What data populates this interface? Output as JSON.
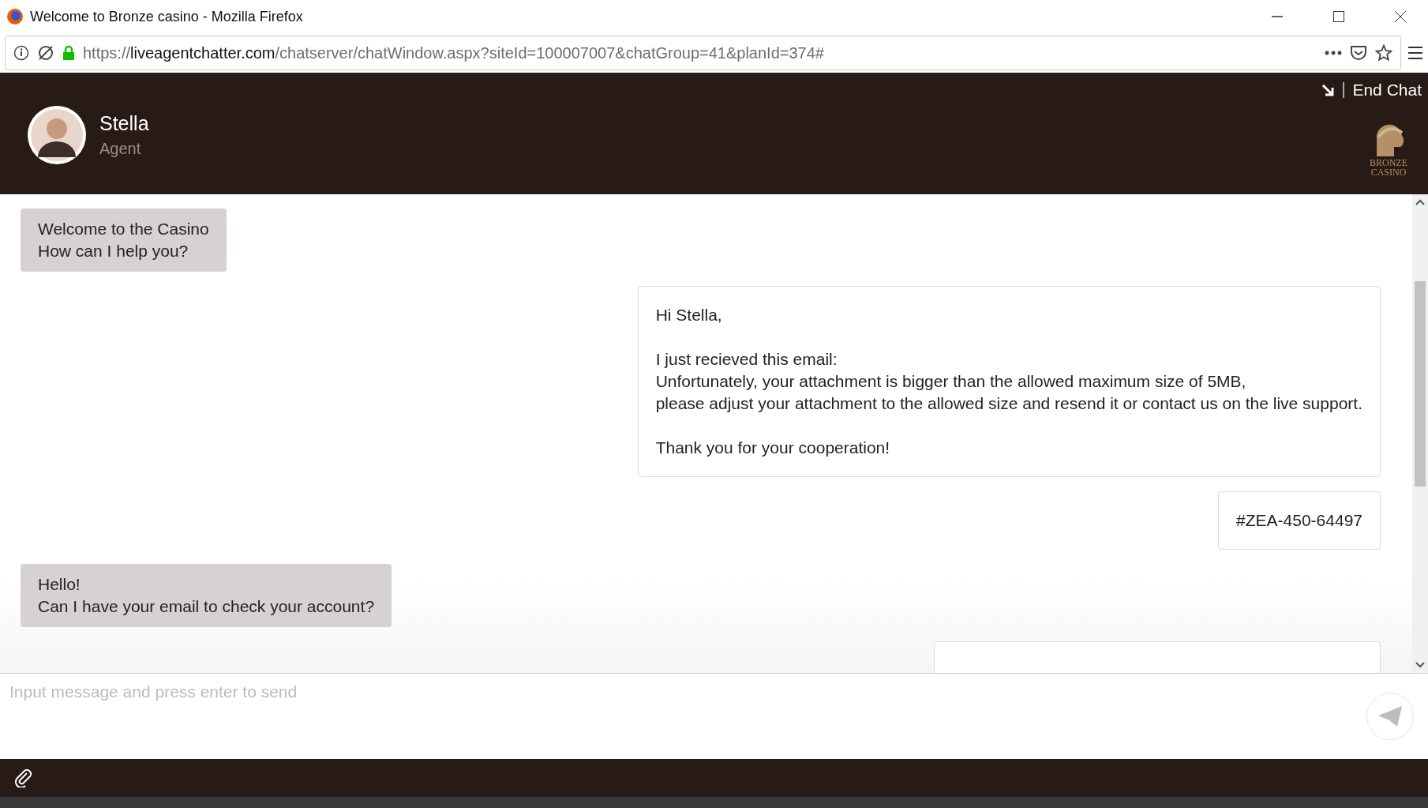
{
  "window": {
    "title": "Welcome to Bronze casino - Mozilla Firefox"
  },
  "address_bar": {
    "url_prefix": "https://",
    "url_domain": "liveagentchatter.com",
    "url_path": "/chatserver/chatWindow.aspx?siteId=100007007&chatGroup=41&planId=374#"
  },
  "header": {
    "agent_name": "Stella",
    "agent_role": "Agent",
    "end_chat": "End Chat",
    "logo_lines": [
      "BRONZE",
      "CASINO"
    ]
  },
  "messages": [
    {
      "kind": "agent",
      "paragraphs": [
        [
          "Welcome to the Casino",
          "How can I help you?"
        ]
      ]
    },
    {
      "kind": "user",
      "paragraphs": [
        [
          "Hi Stella,"
        ],
        [
          "I just recieved this email:",
          "Unfortunately, your attachment is bigger than the allowed maximum size of 5MB,",
          "please adjust your attachment to the allowed size and resend it or contact us on the live support."
        ],
        [
          "Thank you for your cooperation!"
        ]
      ]
    },
    {
      "kind": "user",
      "paragraphs": [
        [
          "#ZEA-450-64497"
        ]
      ]
    },
    {
      "kind": "agent",
      "paragraphs": [
        [
          "Hello!",
          "Can I have your email to check your account?"
        ]
      ]
    },
    {
      "kind": "user"
    }
  ],
  "composer": {
    "placeholder": "Input message and press enter to send"
  }
}
